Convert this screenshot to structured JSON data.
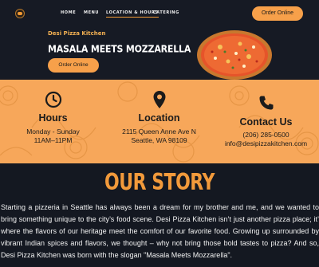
{
  "nav": {
    "links": [
      "HOME",
      "MENU",
      "LOCATION & HOURS",
      "CATERING"
    ],
    "cta_label": "Order Online"
  },
  "hero": {
    "kicker": "Desi Pizza Kitchen",
    "title": "MASALA MEETS MOZZARELLA",
    "cta_label": "Order Online"
  },
  "info": {
    "hours": {
      "icon": "clock-icon",
      "title": "Hours",
      "line1": "Monday - Sunday",
      "line2": "11AM–11PM"
    },
    "location": {
      "icon": "map-pin-icon",
      "title": "Location",
      "line1": "2115 Queen Anne Ave N",
      "line2": "Seattle, WA 98109"
    },
    "contact": {
      "icon": "phone-icon",
      "title": "Contact Us",
      "line1": "(206) 285-0500",
      "line2": "info@desipizzakitchen.com"
    }
  },
  "story": {
    "title": "OUR STORY",
    "body": "Starting a pizzeria in Seattle has always been a dream for my brother and me, and we wanted to bring something unique to the city’s food scene. Desi Pizza Kitchen isn’t just another pizza place; it’ where the flavors of our heritage meet the comfort of our favorite food. Growing up surrounded by vibrant Indian spices and flavors, we thought – why not bring those bold tastes to pizza? And so, Desi Pizza Kitchen was born with the slogan \"Masala Meets Mozzarella\"."
  },
  "colors": {
    "accent": "#f7a04a",
    "band": "#f7a75a",
    "background": "#141821",
    "title": "#f29a3b"
  }
}
